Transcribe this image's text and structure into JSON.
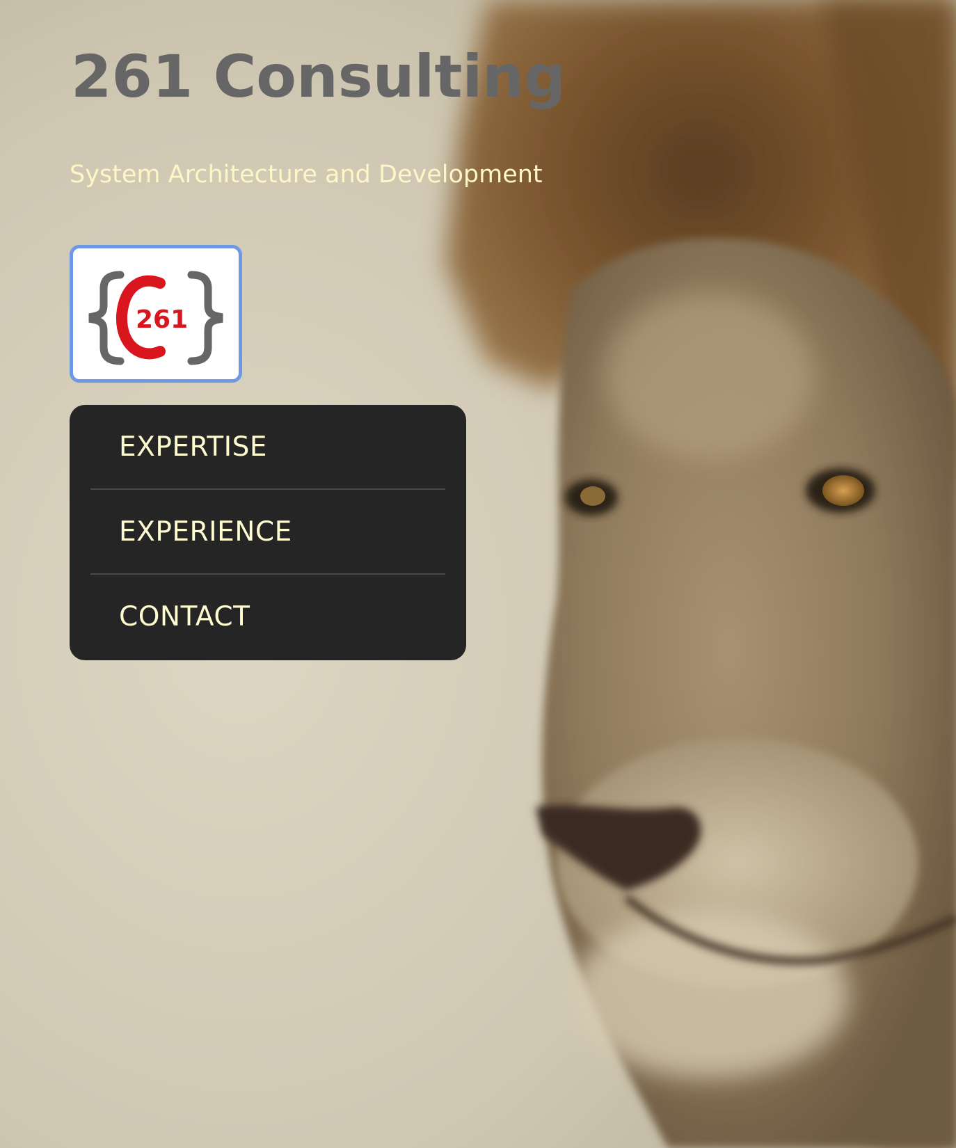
{
  "header": {
    "title": "261 Consulting",
    "tagline": "System Architecture and Development"
  },
  "logo": {
    "text": "261",
    "icon": "c261-brace-logo",
    "colors": {
      "brace": "#666666",
      "c_letter": "#d9161e",
      "number": "#d9161e",
      "border": "#6f97e8"
    }
  },
  "nav": {
    "items": [
      {
        "label": "EXPERTISE"
      },
      {
        "label": "EXPERIENCE"
      },
      {
        "label": "CONTACT"
      }
    ]
  },
  "background": {
    "description_icon": "lion-photo"
  },
  "colors": {
    "title": "#666666",
    "tagline": "#fdf6c6",
    "nav_bg": "#252525",
    "nav_text": "#fffbd0",
    "nav_divider": "#4a4a4a"
  }
}
